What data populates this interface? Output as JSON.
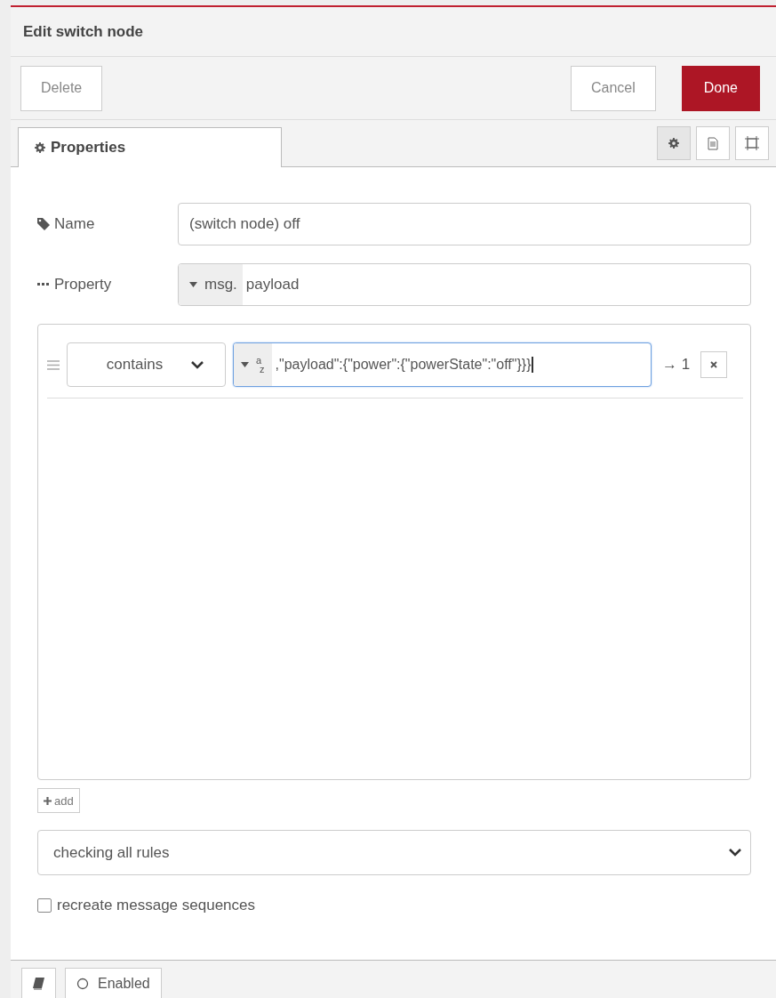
{
  "dialog": {
    "title": "Edit switch node"
  },
  "buttons": {
    "delete": "Delete",
    "cancel": "Cancel",
    "done": "Done"
  },
  "tabs": [
    {
      "label": "Properties",
      "selected": true
    }
  ],
  "side_tabs": [
    {
      "kind": "settings",
      "selected": true
    },
    {
      "kind": "description",
      "selected": false
    },
    {
      "kind": "appearance",
      "selected": false
    }
  ],
  "fields": [
    {
      "kind": "name",
      "label": "Name",
      "value": "(switch node) off"
    },
    {
      "kind": "property",
      "label": "Property",
      "prefix": "msg.",
      "value": "payload"
    }
  ],
  "rules": [
    {
      "operator": "contains",
      "type_label": [
        "a",
        "z"
      ],
      "value": ",\"payload\":{\"power\":{\"powerState\":\"off\"}}}",
      "focused": true,
      "output": "→ 1"
    }
  ],
  "add_button": "add",
  "mode": "checking all rules",
  "checkbox": {
    "label": "recreate message sequences",
    "checked": false
  },
  "footer": {
    "toggle": "Enabled"
  }
}
